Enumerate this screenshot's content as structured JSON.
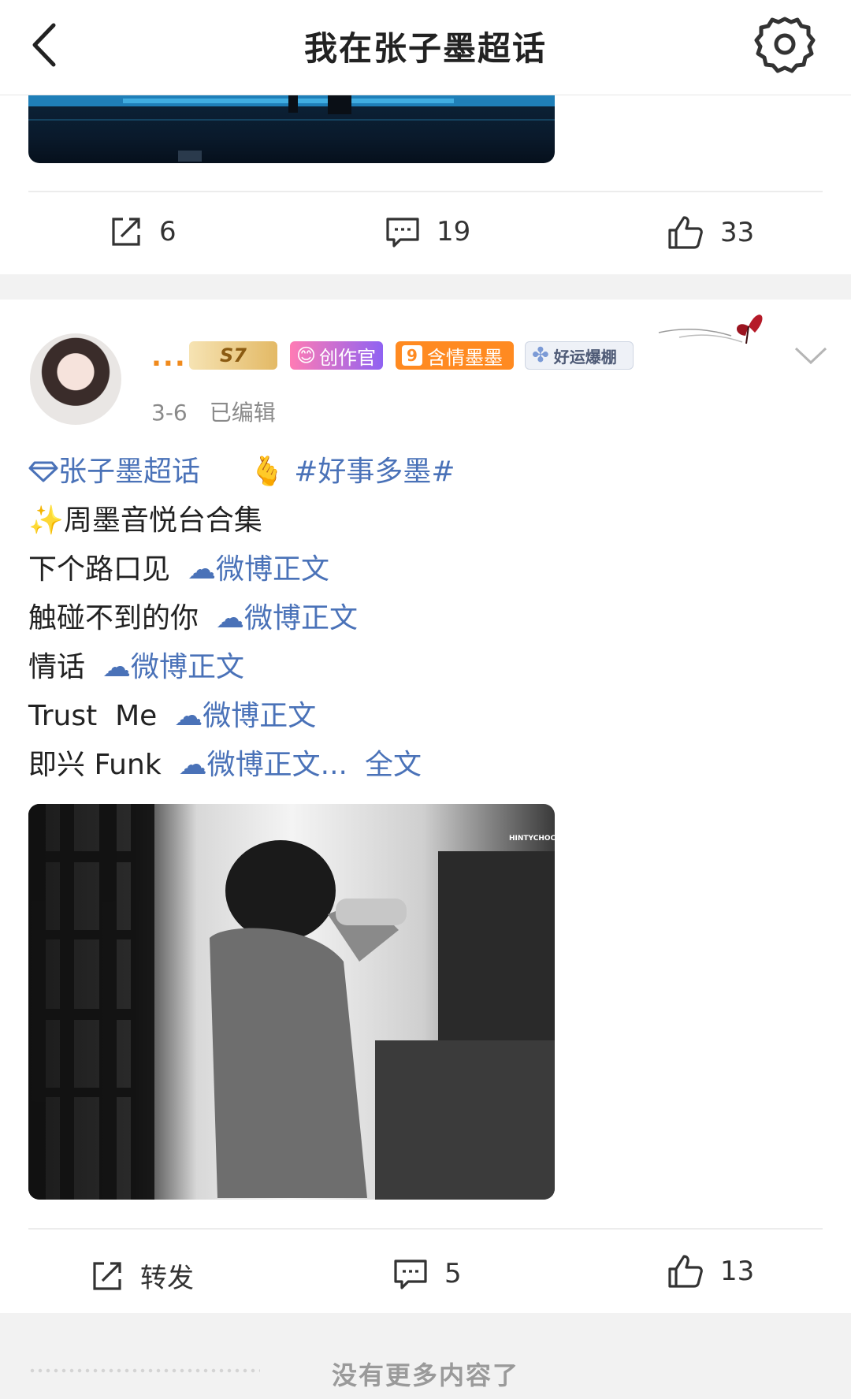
{
  "header": {
    "title": "我在张子墨超话"
  },
  "previous_post": {
    "actions": {
      "repost_count": "6",
      "comment_count": "19",
      "like_count": "33"
    }
  },
  "post": {
    "username": "...",
    "badges": {
      "level": "S7",
      "creator": "创作官",
      "fan_level": "9",
      "fan_name": "含情墨墨",
      "lucky": "好运爆棚"
    },
    "date": "3-6",
    "edited": "已编辑",
    "supertopic_link": "张子墨超话",
    "hashtag": "#好事多墨#",
    "title_line": "周墨音悦台合集",
    "songs": [
      {
        "name": "下个路口见",
        "link": "微博正文"
      },
      {
        "name": "触碰不到的你",
        "link": "微博正文"
      },
      {
        "name": "情话",
        "link": "微博正文"
      },
      {
        "name": "Trust  Me",
        "link": "微博正文"
      },
      {
        "name": "即兴 Funk",
        "link": "微博正文..."
      }
    ],
    "full_text_link": "全文",
    "image_watermark": "HINTYCHOCO",
    "actions": {
      "repost_label": "转发",
      "comment_count": "5",
      "like_count": "13"
    }
  },
  "footer": {
    "no_more": "没有更多内容了"
  },
  "colors": {
    "link": "#4a72b8",
    "username": "#f08a1c",
    "background_band": "#f2f2f2"
  }
}
